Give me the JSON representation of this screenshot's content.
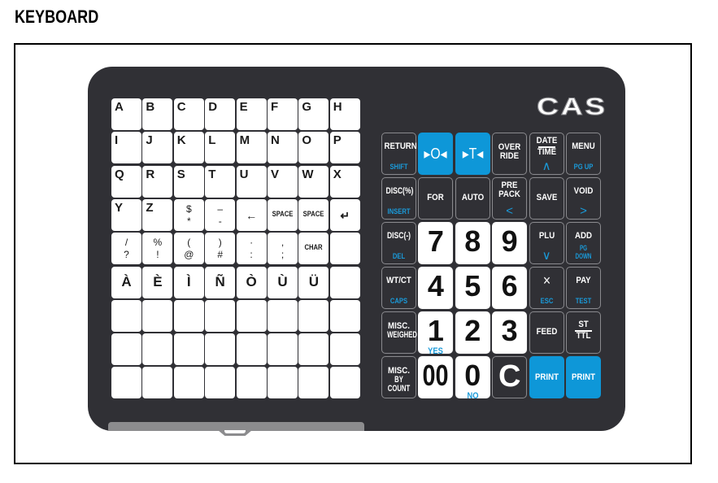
{
  "heading": "KEYBOARD",
  "brand": "CAS",
  "colors": {
    "accent_blue": "#0e97d8",
    "body": "#303035",
    "sub_label": "#1a9ad9"
  },
  "left_keys": [
    [
      {
        "main": "A"
      },
      {
        "main": "B"
      },
      {
        "main": "C"
      },
      {
        "main": "D"
      },
      {
        "main": "E"
      },
      {
        "main": "F"
      },
      {
        "main": "G"
      },
      {
        "main": "H"
      }
    ],
    [
      {
        "main": "I"
      },
      {
        "main": "J"
      },
      {
        "main": "K"
      },
      {
        "main": "L"
      },
      {
        "main": "M"
      },
      {
        "main": "N"
      },
      {
        "main": "O"
      },
      {
        "main": "P"
      }
    ],
    [
      {
        "main": "Q"
      },
      {
        "main": "R"
      },
      {
        "main": "S"
      },
      {
        "main": "T"
      },
      {
        "main": "U"
      },
      {
        "main": "V"
      },
      {
        "main": "W"
      },
      {
        "main": "X"
      }
    ],
    [
      {
        "main": "Y"
      },
      {
        "main": "Z"
      },
      {
        "top": "$",
        "bottom": "*"
      },
      {
        "top": "–",
        "bottom": "-"
      },
      {
        "mid": "←"
      },
      {
        "small": "SPACE"
      },
      {
        "small": "SPACE"
      },
      {
        "mid": "↵"
      }
    ],
    [
      {
        "top": "/",
        "bottom": "?"
      },
      {
        "top": "%",
        "bottom": "!"
      },
      {
        "top": "(",
        "bottom": "@"
      },
      {
        "top": ")",
        "bottom": "#"
      },
      {
        "top": "·",
        "bottom": ":"
      },
      {
        "top": ",",
        "bottom": ";"
      },
      {
        "small": "CHAR"
      },
      {}
    ],
    [
      {
        "accent": "À"
      },
      {
        "accent": "È"
      },
      {
        "accent": "Ì"
      },
      {
        "accent": "Ñ"
      },
      {
        "accent": "Ò"
      },
      {
        "accent": "Ù"
      },
      {
        "accent": "Ü"
      },
      {}
    ],
    [
      {},
      {},
      {},
      {},
      {},
      {},
      {},
      {}
    ],
    [
      {},
      {},
      {},
      {},
      {},
      {},
      {},
      {}
    ],
    [
      {},
      {},
      {},
      {},
      {},
      {},
      {},
      {}
    ]
  ],
  "right_keys": [
    [
      {
        "style": "dark",
        "label": "RETURN",
        "sub": "SHIFT"
      },
      {
        "style": "blue",
        "label": "▸O◂",
        "kind": "zero"
      },
      {
        "style": "blue",
        "label": "▸T◂",
        "kind": "tare"
      },
      {
        "style": "dark",
        "label": "OVER",
        "label2": "RIDE"
      },
      {
        "style": "dark",
        "label": "DATE",
        "label2": "TIME",
        "arrow": "∧",
        "kind": "fraction"
      },
      {
        "style": "dark",
        "label": "MENU",
        "sub": "PG UP"
      }
    ],
    [
      {
        "style": "dark",
        "label": "DISC(%)",
        "sub": "INSERT"
      },
      {
        "style": "dark",
        "label": "FOR"
      },
      {
        "style": "dark",
        "label": "AUTO"
      },
      {
        "style": "dark",
        "label": "PRE",
        "label2": "PACK",
        "arrow": "<"
      },
      {
        "style": "dark",
        "label": "SAVE"
      },
      {
        "style": "dark",
        "label": "VOID",
        "arrow": ">"
      }
    ],
    [
      {
        "style": "dark",
        "label": "DISC(-)",
        "sub": "DEL"
      },
      {
        "style": "white",
        "big": "7"
      },
      {
        "style": "white",
        "big": "8"
      },
      {
        "style": "white",
        "big": "9"
      },
      {
        "style": "dark",
        "label": "PLU",
        "arrow": "∨"
      },
      {
        "style": "dark",
        "label": "ADD",
        "sub": "PG DOWN"
      }
    ],
    [
      {
        "style": "dark",
        "label": "WT/CT",
        "sub": "CAPS"
      },
      {
        "style": "white",
        "big": "4"
      },
      {
        "style": "white",
        "big": "5"
      },
      {
        "style": "white",
        "big": "6"
      },
      {
        "style": "dark",
        "label": "×",
        "sub": "ESC",
        "kind": "times"
      },
      {
        "style": "dark",
        "label": "PAY",
        "sub": "TEST"
      }
    ],
    [
      {
        "style": "dark",
        "label": "MISC.",
        "label2": "WEIGHED"
      },
      {
        "style": "white",
        "big": "1",
        "sub": "YES"
      },
      {
        "style": "white",
        "big": "2"
      },
      {
        "style": "white",
        "big": "3"
      },
      {
        "style": "dark",
        "label": "FEED"
      },
      {
        "style": "dark",
        "label": "ST",
        "label2": "TTL",
        "kind": "fraction"
      }
    ],
    [
      {
        "style": "dark",
        "label": "MISC.",
        "label2": "BY COUNT"
      },
      {
        "style": "white",
        "big": "00"
      },
      {
        "style": "white",
        "big": "0",
        "sub": "NO"
      },
      {
        "style": "dark",
        "big": "C"
      },
      {
        "style": "blue",
        "label": "PRINT"
      },
      {
        "style": "blue",
        "label": "PRINT"
      }
    ]
  ]
}
